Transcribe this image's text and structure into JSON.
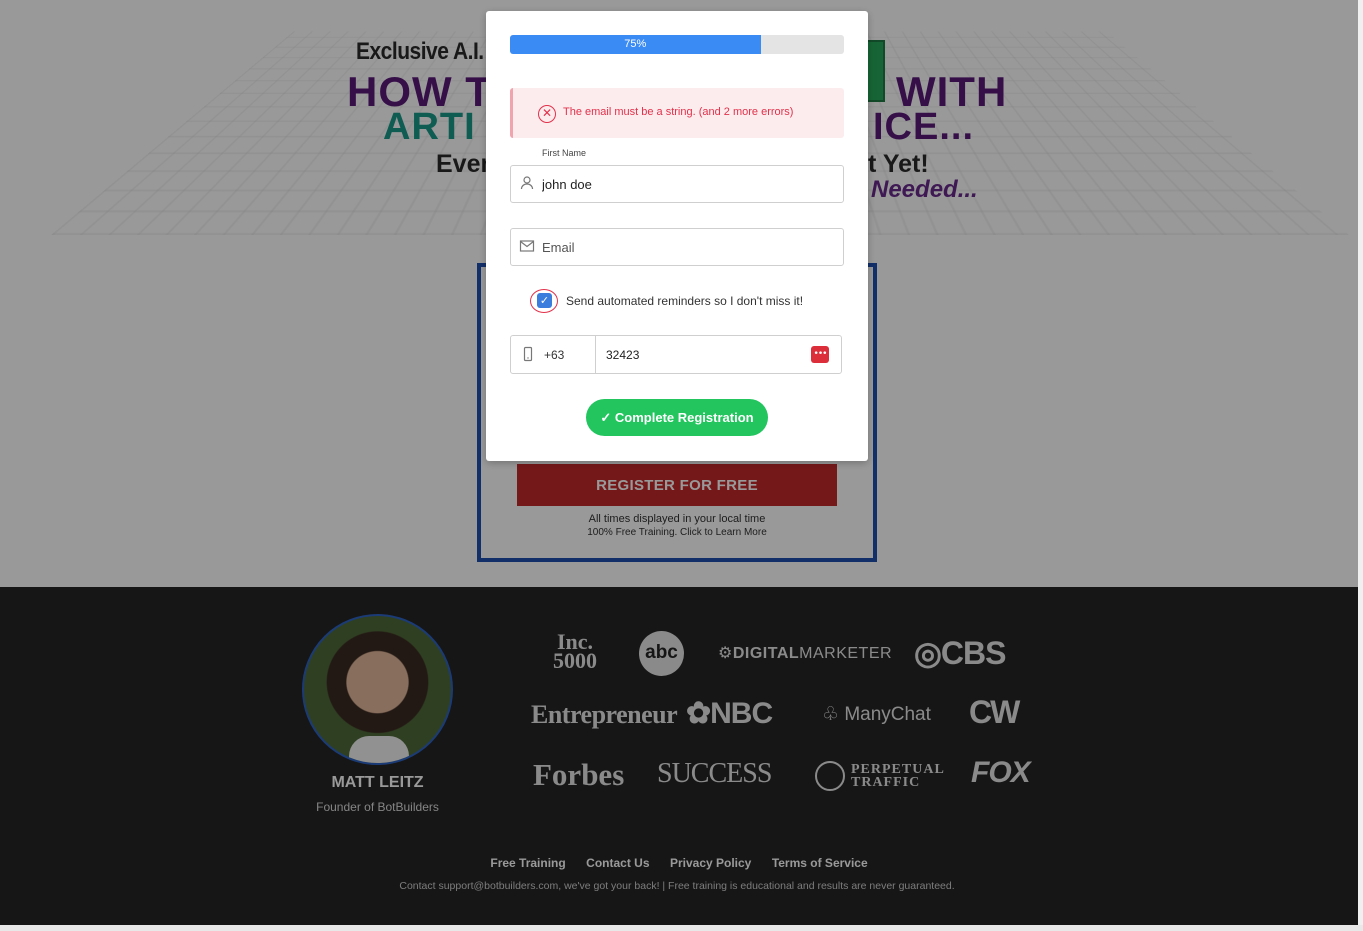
{
  "hero": {
    "headline_line1": "Exclusive A.I. Tra",
    "headline_how": "HOW T",
    "headline_with": "WITH",
    "headline_arti": "ARTI",
    "headline_ice": "ICE...",
    "headline_even": "Even",
    "headline_yet": "t Yet!",
    "headline_needed": "Needed..."
  },
  "registration": {
    "button_label": "REGISTER FOR FREE",
    "note_times": "All times displayed in your local time",
    "note_training": "100% Free Training. Click to Learn More"
  },
  "modal": {
    "progress": {
      "label": "75%",
      "value": 0.75,
      "fill_color": "#3b8bf5"
    },
    "alert": {
      "text": "The email must be a string. (and 2 more errors)",
      "icon": "x-circle-icon",
      "color": "#e2314a"
    },
    "first_name": {
      "label": "First Name",
      "value": "john doe",
      "icon": "user-icon"
    },
    "email": {
      "placeholder": "Email",
      "value": "",
      "icon": "mail-icon"
    },
    "reminder": {
      "label": "Send automated reminders so I don't miss it!",
      "checked": true
    },
    "phone": {
      "country_code": "+63",
      "value": "32423",
      "icon": "mobile-icon",
      "badge_icon": "password-manager-icon"
    },
    "submit_label": "✓ Complete Registration",
    "submit_color": "#22c55e"
  },
  "footer": {
    "person_name": "MATT LEITZ",
    "person_role": "Founder of BotBuilders",
    "logos": {
      "inc_line1": "Inc.",
      "inc_line2": "5000",
      "abc": "abc",
      "dm_bold": "DIGITAL",
      "dm_rest": "MARKETER",
      "cbs": "◎CBS",
      "entrepreneur": "Entrepreneur",
      "nbc": "NBC",
      "manychat": "ManyChat",
      "cw": "CW",
      "forbes": "Forbes",
      "success": "SUCCESS",
      "pt_line1": "PERPETUAL",
      "pt_line2": "TRAFFIC",
      "fox": "FOX"
    },
    "links": [
      "Free Training",
      "Contact Us",
      "Privacy Policy",
      "Terms of Service"
    ],
    "contact": "Contact support@botbuilders.com, we've got your back! | Free training is educational and results are never guaranteed."
  }
}
